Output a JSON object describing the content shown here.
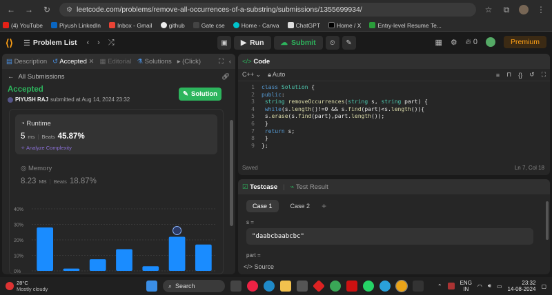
{
  "browser": {
    "url": "leetcode.com/problems/remove-all-occurrences-of-a-substring/submissions/1355699934/",
    "bookmarks": [
      "(4) YouTube",
      "Piyush LinkedIn",
      "Inbox - Gmail",
      "github",
      "Gate cse",
      "Home - Canva",
      "ChatGPT",
      "Home / X",
      "Entry-level Resume Te..."
    ]
  },
  "leetcode_header": {
    "problem_list": "Problem List",
    "run": "Run",
    "submit": "Submit",
    "streak_count": "0",
    "premium": "Premium"
  },
  "left_tabs": {
    "description": "Description",
    "accepted": "Accepted",
    "editorial": "Editorial",
    "solutions": "Solutions",
    "click": "(Click)"
  },
  "submission": {
    "all_submissions": "All Submissions",
    "status": "Accepted",
    "user": "PIYUSH RAJ",
    "submitted_text": "submitted at Aug 14, 2024 23:32",
    "solution_button": "Solution",
    "runtime_label": "Runtime",
    "runtime_value": "5",
    "runtime_unit": "ms",
    "beats_label": "Beats",
    "runtime_beats": "45.87%",
    "analyze": "Analyze Complexity",
    "memory_label": "Memory",
    "memory_value": "8.23",
    "memory_unit": "MB",
    "memory_beats": "18.87%"
  },
  "chart_data": {
    "type": "bar",
    "yticks": [
      "40%",
      "30%",
      "20%",
      "10%",
      "0%"
    ],
    "ylim": [
      0,
      40
    ],
    "values": [
      28,
      1.5,
      7.5,
      14,
      3,
      22,
      17
    ],
    "highlight_index": 5
  },
  "code_panel": {
    "title": "Code",
    "language": "C++",
    "auto": "Auto",
    "lines": [
      "class Solution {",
      "public:",
      "    string removeOccurrences(string s, string part) {",
      "        while(s.length()!=0 && s.find(part)<s.length()){",
      "            s.erase(s.find(part),part.length());",
      "        }",
      "        return s;",
      "    }",
      "};"
    ],
    "saved": "Saved",
    "cursor": "Ln 7, Col 18"
  },
  "testcase_panel": {
    "tab_testcase": "Testcase",
    "tab_result": "Test Result",
    "case1": "Case 1",
    "case2": "Case 2",
    "s_label": "s =",
    "s_value": "\"daabcbaabcbc\"",
    "part_label": "part =",
    "source": "Source"
  },
  "taskbar": {
    "temp": "28°C",
    "weather": "Mostly cloudy",
    "search": "Search",
    "lang1": "ENG",
    "lang2": "IN",
    "time": "23:32",
    "date": "14-08-2024"
  }
}
